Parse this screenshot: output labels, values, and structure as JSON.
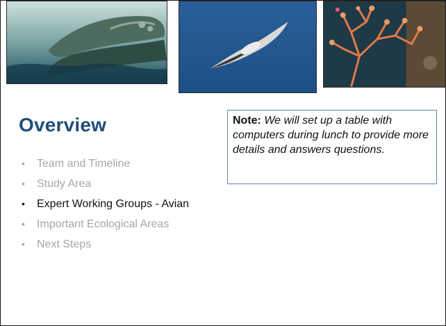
{
  "slide": {
    "title": "Overview",
    "agenda": [
      {
        "label": "Team and Timeline",
        "active": false
      },
      {
        "label": "Study Area",
        "active": false
      },
      {
        "label": "Expert Working Groups - Avian",
        "active": true
      },
      {
        "label": "Important Ecological Areas",
        "active": false
      },
      {
        "label": "Next Steps",
        "active": false
      }
    ],
    "bullet_glyph": "•",
    "note": {
      "label": "Note:",
      "text": "We will set up a table with computers during lunch to provide more details and answers questions."
    }
  },
  "colors": {
    "title": "#1f4e79",
    "active_item": "#111111",
    "inactive_item": "#a6a6a6",
    "note_border": "#5b86b5"
  },
  "images": [
    {
      "name": "whale-photo"
    },
    {
      "name": "seabird-photo"
    },
    {
      "name": "coral-photo"
    }
  ]
}
